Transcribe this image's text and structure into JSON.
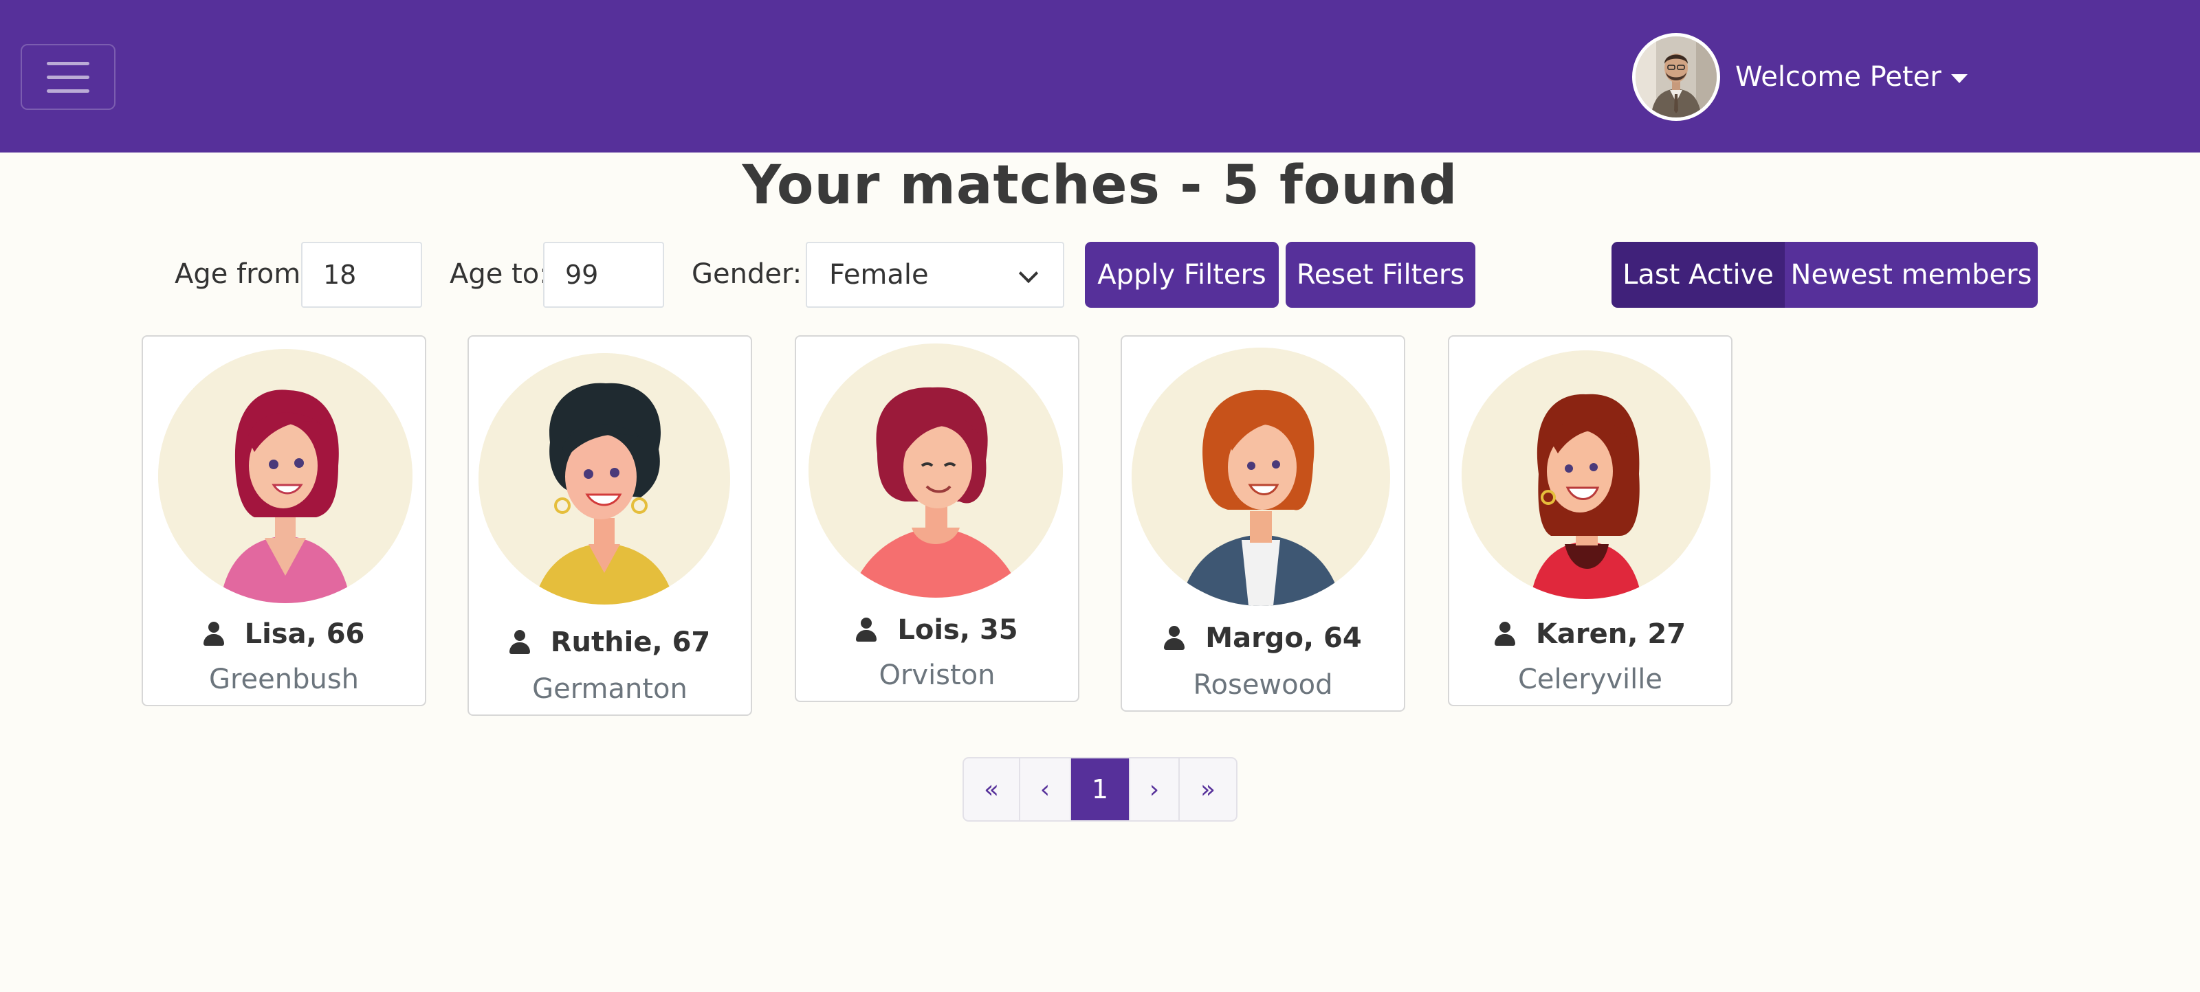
{
  "nav": {
    "welcome": "Welcome Peter"
  },
  "title": "Your matches - 5 found",
  "filters": {
    "age_from_label": "Age from:",
    "age_from_value": "18",
    "age_to_label": "Age to:",
    "age_to_value": "99",
    "gender_label": "Gender:",
    "gender_value": "Female",
    "apply_label": "Apply Filters",
    "reset_label": "Reset Filters"
  },
  "sort": {
    "last_active": "Last Active",
    "newest": "Newest members",
    "selected": "Last Active"
  },
  "members": [
    {
      "name": "Lisa, 66",
      "city": "Greenbush"
    },
    {
      "name": "Ruthie, 67",
      "city": "Germanton"
    },
    {
      "name": "Lois, 35",
      "city": "Orviston"
    },
    {
      "name": "Margo, 64",
      "city": "Rosewood"
    },
    {
      "name": "Karen, 27",
      "city": "Celeryville"
    }
  ],
  "pagination": {
    "first": "«",
    "prev": "‹",
    "current": "1",
    "next": "›",
    "last": "»"
  },
  "colors": {
    "brand": "#56309a",
    "brand_dark": "#40217a",
    "page_bg": "#fdfcf7"
  }
}
